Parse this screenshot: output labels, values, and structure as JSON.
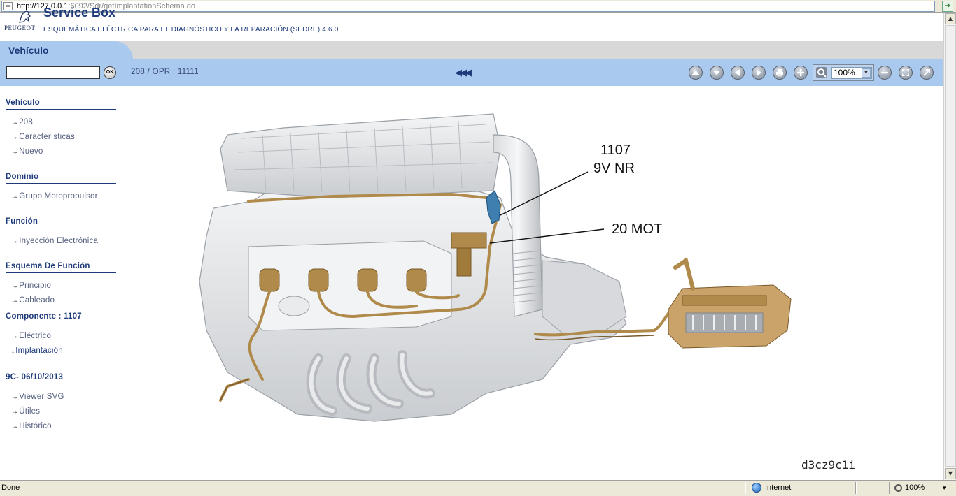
{
  "browser": {
    "url_host": "http://127.0.0.1",
    "url_rest": ":6092/Sdr/getImplantationSchema.do"
  },
  "header": {
    "brand": "PEUGEOT",
    "app_title": "Service Box",
    "subtitle": "ESQUEMÁTICA ELÉCTRICA PARA EL DIAGNÓSTICO Y LA REPARACIÓN (SEDRE) 4.6.0"
  },
  "tab": {
    "label": "Vehículo"
  },
  "toolbar": {
    "search_value": "",
    "ok_label": "OK",
    "breadcrumb": "208  /  OPR : 11111",
    "rewind": "◀◀◀",
    "zoom_value": "100%",
    "zoom_arrow": "▼",
    "buttons": [
      "arrow-up-icon",
      "arrow-down-icon",
      "arrow-left-icon",
      "arrow-right-icon",
      "print-icon",
      "plus-icon",
      "zoom-in-icon",
      "minus-icon",
      "fit-screen-icon",
      "fullscreen-icon"
    ]
  },
  "sidebar": {
    "sections": [
      {
        "title": "Vehículo",
        "items": [
          "208",
          "Características",
          "Nuevo"
        ]
      },
      {
        "title": "Dominio",
        "items": [
          "Grupo Motopropulsor"
        ]
      },
      {
        "title": "Función",
        "items": [
          "Inyección Electrónica"
        ]
      },
      {
        "title": "Esquema De Función",
        "items": [
          "Principio",
          "Cableado"
        ]
      },
      {
        "title": "Componente : 1107",
        "items": [
          "Eléctrico",
          "Implantación"
        ]
      },
      {
        "title": "9C- 06/10/2013",
        "items": [
          "Viewer SVG",
          "Útiles",
          "Histórico"
        ]
      }
    ],
    "arrow": "→",
    "current_arrow": "↓"
  },
  "drawing": {
    "label_component": "1107",
    "label_code": "9V NR",
    "label_connector": "20 MOT",
    "watermark": "d3cz9c1i",
    "colors": {
      "engine": "#e4e6e8",
      "engine_edge": "#9aa0a6",
      "harness": "#b08a4a",
      "harness_dark": "#7a5a2a",
      "sensor": "#3f7fb0"
    }
  },
  "status": {
    "text": "Done",
    "zone": "Internet",
    "zoom": "100%",
    "zoom_arrow": "▼"
  }
}
